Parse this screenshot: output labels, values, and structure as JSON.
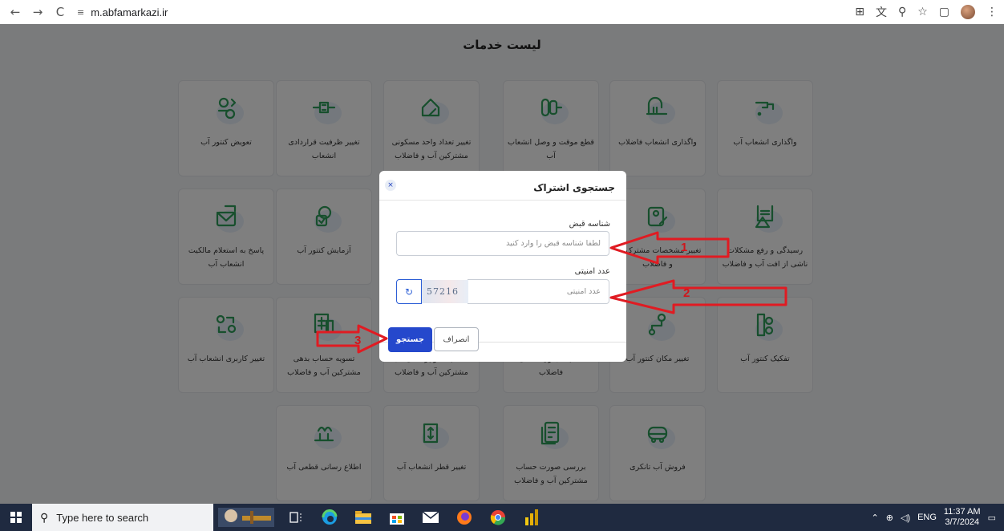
{
  "browser": {
    "url": "m.abfamarkazi.ir",
    "back_icon": "←",
    "forward_icon": "→",
    "reload_icon": "C",
    "site_info_icon": "≡",
    "right_icons": [
      "⊞",
      "文",
      "⚲",
      "☆",
      "▢",
      "⋮"
    ]
  },
  "page": {
    "title": "لیست خدمات",
    "services": [
      {
        "label": "واگذاری انشعاب آب",
        "icon": "water-tap-icon"
      },
      {
        "label": "واگذاری انشعاب فاضلاب",
        "icon": "sewage-icon"
      },
      {
        "label": "قطع موقت و وصل انشعاب آب",
        "icon": "valve-icon"
      },
      {
        "label": "تغییر تعداد واحد مسکونی مشترکین آب و فاضلاب",
        "icon": "house-edit-icon"
      },
      {
        "label": "تغییر ظرفیت قراردادی انشعاب",
        "icon": "pipe-capacity-icon"
      },
      {
        "label": "تعویض کنتور آب",
        "icon": "meter-swap-icon"
      },
      {
        "label": "رسیدگی و رفع مشکلات ناشی از افت آب و فاضلاب",
        "icon": "receipt-warning-icon"
      },
      {
        "label": "تغییر مشخصات مشترک آب و فاضلاب",
        "icon": "profile-edit-icon"
      },
      {
        "label": "",
        "icon": ""
      },
      {
        "label": "",
        "icon": ""
      },
      {
        "label": "آزمایش کنتور آب",
        "icon": "meter-test-icon"
      },
      {
        "label": "پاسخ به استعلام مالکیت انشعاب آب",
        "icon": "mail-reply-icon"
      },
      {
        "label": "تفکیک کنتور آب",
        "icon": "meter-split-icon"
      },
      {
        "label": "تغییر مکان کنتور آب",
        "icon": "route-pin-icon"
      },
      {
        "label": "نصب سیفون اتمامی فاضلاب",
        "icon": ""
      },
      {
        "label": "حساب ها و پرداختی‌های مشترکین آب و فاضلاب",
        "icon": ""
      },
      {
        "label": "تسویه حساب بدهی مشترکین آب و فاضلاب",
        "icon": "invoice-icon"
      },
      {
        "label": "تغییر کاربری انشعاب آب",
        "icon": "user-switch-icon"
      },
      {
        "label": "فروش آب تانکری",
        "icon": "tanker-icon"
      },
      {
        "label": "بررسی صورت حساب مشترکین آب و فاضلاب",
        "icon": "bill-review-icon"
      },
      {
        "label": "تغییر قطر انشعاب آب",
        "icon": "pipe-diameter-icon"
      },
      {
        "label": "اطلاع رسانی قطعی آب",
        "icon": "fountain-icon"
      }
    ]
  },
  "modal": {
    "title": "جستجوی اشتراک",
    "close_icon": "×",
    "bill_id_label": "شناسه قبض",
    "bill_id_placeholder": "لطفا شناسه قبض را وارد کنید",
    "captcha_label": "عدد امنیتی",
    "captcha_placeholder": "عدد امنیتی",
    "captcha_text": "57216",
    "refresh_icon": "↻",
    "search_button": "جستجو",
    "cancel_button": "انصراف"
  },
  "annotations": [
    "1",
    "2",
    "3"
  ],
  "taskbar": {
    "search_placeholder": "Type here to search",
    "search_glyph": "⚲",
    "language": "ENG",
    "time": "11:37 AM",
    "date": "3/7/2024"
  },
  "colors": {
    "primary": "#2548cc",
    "annotation_red": "#d0161c",
    "taskbar": "#1f2a40",
    "icon_green": "#2e9e5b"
  }
}
